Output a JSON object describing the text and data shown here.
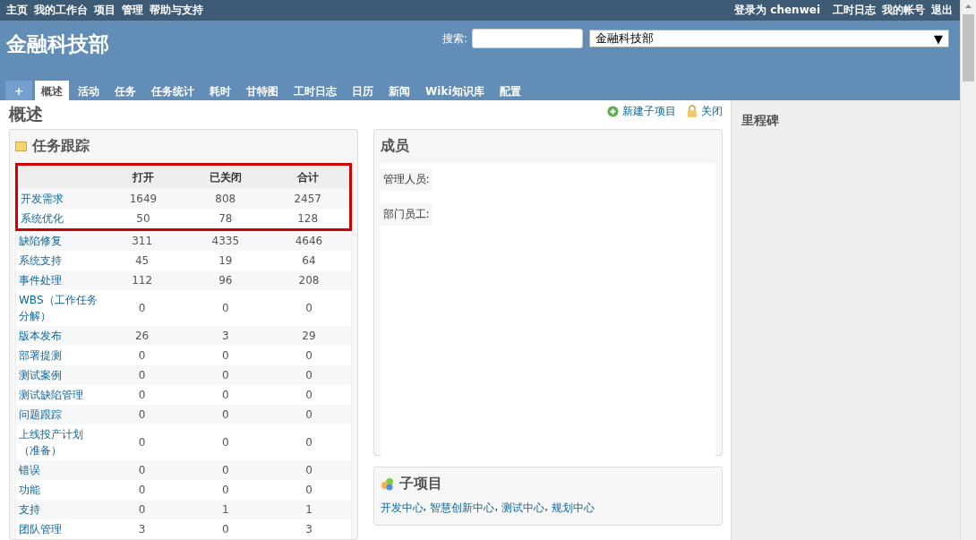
{
  "top_menu": {
    "left": [
      "主页",
      "我的工作台",
      "项目",
      "管理",
      "帮助与支持"
    ],
    "login_label": "登录为",
    "login_user": "chenwei",
    "right": [
      "工时日志",
      "我的帐号",
      "退出"
    ]
  },
  "header": {
    "title": "金融科技部",
    "search_label": "搜索:",
    "project_select": "金融科技部",
    "select_arrow": "▼"
  },
  "tabs": [
    {
      "label": "+",
      "kind": "new",
      "selected": false
    },
    {
      "label": "概述",
      "kind": "tab",
      "selected": true
    },
    {
      "label": "活动",
      "kind": "tab",
      "selected": false
    },
    {
      "label": "任务",
      "kind": "tab",
      "selected": false
    },
    {
      "label": "任务统计",
      "kind": "tab",
      "selected": false
    },
    {
      "label": "耗时",
      "kind": "tab",
      "selected": false
    },
    {
      "label": "甘特图",
      "kind": "tab",
      "selected": false
    },
    {
      "label": "工时日志",
      "kind": "tab",
      "selected": false
    },
    {
      "label": "日历",
      "kind": "tab",
      "selected": false
    },
    {
      "label": "新闻",
      "kind": "tab",
      "selected": false
    },
    {
      "label": "Wiki知识库",
      "kind": "tab",
      "selected": false
    },
    {
      "label": "配置",
      "kind": "tab",
      "selected": false
    }
  ],
  "page_title": "概述",
  "actions": [
    {
      "label": "新建子项目",
      "kind": "add"
    },
    {
      "label": "关闭",
      "kind": "lock"
    }
  ],
  "issue_tracking": {
    "title": "任务跟踪",
    "columns": [
      "打开",
      "已关闭",
      "合计"
    ],
    "rows": [
      {
        "name": "开发需求",
        "values": [
          "1649",
          "808",
          "2457"
        ],
        "highlighted": true
      },
      {
        "name": "系统优化",
        "values": [
          "50",
          "78",
          "128"
        ],
        "highlighted": true
      },
      {
        "name": "缺陷修复",
        "values": [
          "311",
          "4335",
          "4646"
        ],
        "highlighted": false
      },
      {
        "name": "系统支持",
        "values": [
          "45",
          "19",
          "64"
        ],
        "highlighted": false
      },
      {
        "name": "事件处理",
        "values": [
          "112",
          "96",
          "208"
        ],
        "highlighted": false
      },
      {
        "name": "WBS（工作任务分解）",
        "values": [
          "0",
          "0",
          "0"
        ],
        "highlighted": false
      },
      {
        "name": "版本发布",
        "values": [
          "26",
          "3",
          "29"
        ],
        "highlighted": false
      },
      {
        "name": "部署提测",
        "values": [
          "0",
          "0",
          "0"
        ],
        "highlighted": false
      },
      {
        "name": "测试案例",
        "values": [
          "0",
          "0",
          "0"
        ],
        "highlighted": false
      },
      {
        "name": "测试缺陷管理",
        "values": [
          "0",
          "0",
          "0"
        ],
        "highlighted": false
      },
      {
        "name": "问题跟踪",
        "values": [
          "0",
          "0",
          "0"
        ],
        "highlighted": false
      },
      {
        "name": "上线投产计划（准备）",
        "values": [
          "0",
          "0",
          "0"
        ],
        "highlighted": false
      },
      {
        "name": "错误",
        "values": [
          "0",
          "0",
          "0"
        ],
        "highlighted": false
      },
      {
        "name": "功能",
        "values": [
          "0",
          "0",
          "0"
        ],
        "highlighted": false
      },
      {
        "name": "支持",
        "values": [
          "0",
          "1",
          "1"
        ],
        "highlighted": false
      },
      {
        "name": "团队管理",
        "values": [
          "3",
          "0",
          "3"
        ],
        "highlighted": false
      }
    ]
  },
  "members": {
    "title": "成员",
    "roles": [
      "管理人员:",
      "部门员工:"
    ]
  },
  "subprojects": {
    "title": "子项目",
    "items": [
      "开发中心",
      "智慧创新中心",
      "测试中心",
      "规划中心"
    ],
    "separator": ","
  },
  "sidebar": {
    "title": "里程碑"
  }
}
